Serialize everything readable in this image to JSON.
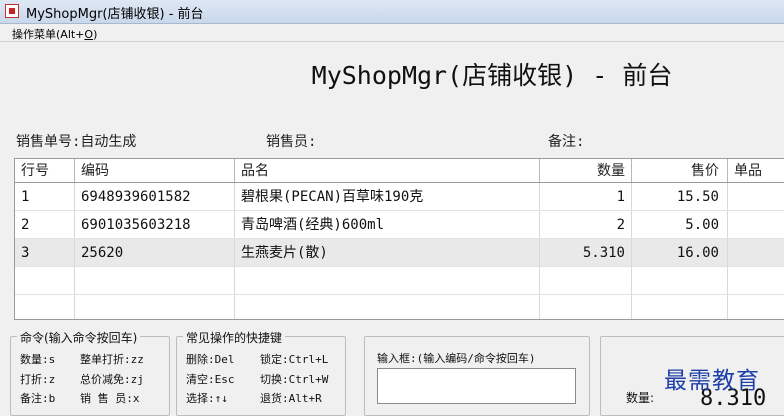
{
  "window": {
    "title": "MyShopMgr(店铺收银) - 前台"
  },
  "menubar": {
    "menu_label": "操作菜单(Alt+",
    "menu_mnemonic": "O",
    "menu_close": ")"
  },
  "header": {
    "title": "MyShopMgr(店铺收银) - 前台"
  },
  "info": {
    "order_no": "销售单号:自动生成",
    "salesperson": "销售员:",
    "note": "备注:"
  },
  "grid": {
    "columns": [
      "行号",
      "编码",
      "品名",
      "数量",
      "售价",
      "单品"
    ],
    "rows": [
      {
        "no": "1",
        "code": "6948939601582",
        "name": "碧根果(PECAN)百草味190克",
        "qty": "1",
        "price": "15.50"
      },
      {
        "no": "2",
        "code": "6901035603218",
        "name": "青岛啤酒(经典)600ml",
        "qty": "2",
        "price": "5.00"
      },
      {
        "no": "3",
        "code": "25620",
        "name": "生燕麦片(散)",
        "qty": "5.310",
        "price": "16.00"
      }
    ]
  },
  "commands": {
    "title": "命令(输入命令按回车)",
    "items": [
      "数量:s",
      "整单打折:zz",
      "打折:z",
      "总价减免:zj",
      "备注:b",
      "销 售 员:x"
    ]
  },
  "shortcuts": {
    "title": "常见操作的快捷键",
    "items": [
      "删除:Del",
      "锁定:Ctrl+L",
      "清空:Esc",
      "切换:Ctrl+W",
      "选择:↑↓",
      "退货:Alt+R"
    ]
  },
  "input_panel": {
    "label": "输入框:(输入编码/命令按回车)",
    "value": ""
  },
  "summary": {
    "qty_label": "数量:",
    "qty_value": "8.310"
  },
  "watermark": {
    "text": "最需教育"
  },
  "colors": {
    "watermark": "#1f3fa8",
    "selected_row": "#e9e9e9"
  }
}
